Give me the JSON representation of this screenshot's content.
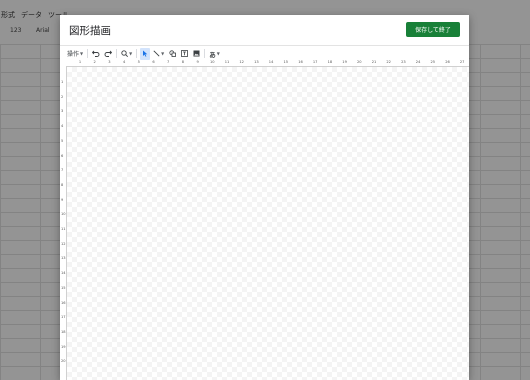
{
  "background": {
    "menu": [
      "形式",
      "データ",
      "ツール"
    ],
    "toolbar": {
      "format_label": "123",
      "font_label": "Arial"
    }
  },
  "dialog": {
    "title": "図形描画",
    "save_button": "保存して終了"
  },
  "toolbar": {
    "actions_label": "操作",
    "undo_icon": "undo-icon",
    "redo_icon": "redo-icon",
    "zoom_icon": "zoom-icon",
    "select_icon": "cursor-icon",
    "line_icon": "line-icon",
    "shape_icon": "shape-icon",
    "textbox_icon": "textbox-icon",
    "image_icon": "image-icon",
    "wordart_label": "あ"
  },
  "ruler": {
    "top_ticks": [
      "1",
      "2",
      "3",
      "4",
      "5",
      "6",
      "7",
      "8",
      "9",
      "10",
      "11",
      "12",
      "13",
      "14",
      "15",
      "16",
      "17",
      "18",
      "19",
      "20",
      "21",
      "22",
      "23",
      "24",
      "25",
      "26",
      "27"
    ],
    "left_ticks": [
      "1",
      "2",
      "3",
      "4",
      "5",
      "6",
      "7",
      "8",
      "9",
      "10",
      "11",
      "12",
      "13",
      "14",
      "15",
      "16",
      "17",
      "18",
      "19",
      "20"
    ]
  },
  "colors": {
    "save_button": "#188038",
    "select_active": "#d2e3fc"
  }
}
